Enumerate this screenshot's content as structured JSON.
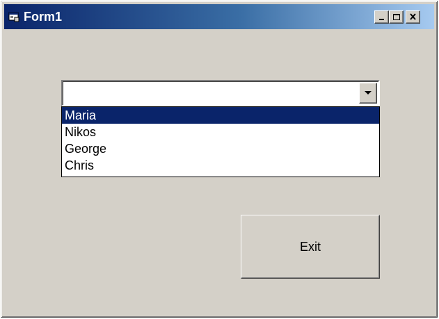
{
  "window": {
    "title": "Form1",
    "app_icon": "form-app-icon",
    "controls": {
      "minimize_icon": "minimize-icon",
      "maximize_icon": "maximize-icon",
      "close_icon": "close-icon"
    }
  },
  "combobox": {
    "value": "",
    "button_icon": "chevron-down-icon",
    "items": [
      "Maria",
      "Nikos",
      "George",
      "Chris"
    ],
    "selected_index": 0
  },
  "exit_button": {
    "label": "Exit"
  },
  "colors": {
    "selection": "#0a246a",
    "face": "#d4d0c8"
  }
}
